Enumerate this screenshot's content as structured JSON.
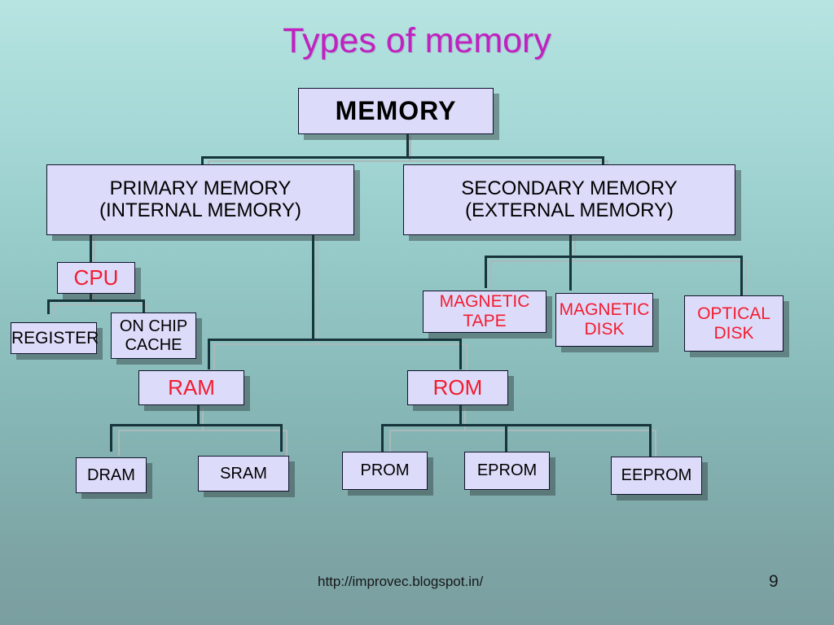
{
  "slide": {
    "title": "Types of memory",
    "title_color": "#c021c0",
    "background_top_color": "#b7e4e1",
    "background_bottom_color": "#7b9fa0",
    "box_fill_color": "#dcdcfa",
    "box_border_color": "#11122b",
    "red_text_color": "#f41b2f",
    "black_text_color": "#000000"
  },
  "footer": {
    "url": "http://improvec.blogspot.in/",
    "page_number": "9"
  },
  "chart_data": {
    "type": "diagram",
    "title": "Types of memory",
    "diagram_kind": "hierarchy-tree",
    "root": "MEMORY",
    "nodes": [
      {
        "id": "memory",
        "label": "MEMORY",
        "text_color": "#000000",
        "level": 0
      },
      {
        "id": "primary",
        "label": "PRIMARY MEMORY\n(INTERNAL MEMORY)",
        "text_color": "#000000",
        "level": 1
      },
      {
        "id": "secondary",
        "label": "SECONDARY MEMORY\n(EXTERNAL MEMORY)",
        "text_color": "#000000",
        "level": 1
      },
      {
        "id": "cpu",
        "label": "CPU",
        "text_color": "#f41b2f",
        "level": 2
      },
      {
        "id": "register",
        "label": "REGISTER",
        "text_color": "#000000",
        "level": 3
      },
      {
        "id": "on-chip-cache",
        "label": "ON CHIP\nCACHE",
        "text_color": "#000000",
        "level": 3
      },
      {
        "id": "ram",
        "label": "RAM",
        "text_color": "#f41b2f",
        "level": 2
      },
      {
        "id": "rom",
        "label": "ROM",
        "text_color": "#f41b2f",
        "level": 2
      },
      {
        "id": "dram",
        "label": "DRAM",
        "text_color": "#000000",
        "level": 3
      },
      {
        "id": "sram",
        "label": "SRAM",
        "text_color": "#000000",
        "level": 3
      },
      {
        "id": "prom",
        "label": "PROM",
        "text_color": "#000000",
        "level": 3
      },
      {
        "id": "eprom",
        "label": "EPROM",
        "text_color": "#000000",
        "level": 3
      },
      {
        "id": "eeprom",
        "label": "EEPROM",
        "text_color": "#000000",
        "level": 3
      },
      {
        "id": "magnetic-tape",
        "label": "MAGNETIC\nTAPE",
        "text_color": "#f41b2f",
        "level": 2
      },
      {
        "id": "magnetic-disk",
        "label": "MAGNETIC\nDISK",
        "text_color": "#f41b2f",
        "level": 2
      },
      {
        "id": "optical-disk",
        "label": "OPTICAL\nDISK",
        "text_color": "#f41b2f",
        "level": 2
      }
    ],
    "edges": [
      {
        "from": "memory",
        "to": "primary"
      },
      {
        "from": "memory",
        "to": "secondary"
      },
      {
        "from": "primary",
        "to": "cpu"
      },
      {
        "from": "primary",
        "to": "ram"
      },
      {
        "from": "primary",
        "to": "rom"
      },
      {
        "from": "cpu",
        "to": "register"
      },
      {
        "from": "cpu",
        "to": "on-chip-cache"
      },
      {
        "from": "ram",
        "to": "dram"
      },
      {
        "from": "ram",
        "to": "sram"
      },
      {
        "from": "rom",
        "to": "prom"
      },
      {
        "from": "rom",
        "to": "eprom"
      },
      {
        "from": "rom",
        "to": "eeprom"
      },
      {
        "from": "secondary",
        "to": "magnetic-tape"
      },
      {
        "from": "secondary",
        "to": "magnetic-disk"
      },
      {
        "from": "secondary",
        "to": "optical-disk"
      }
    ]
  },
  "boxes": {
    "memory": {
      "line1": "MEMORY"
    },
    "primary": {
      "line1": "PRIMARY MEMORY",
      "line2": "(INTERNAL MEMORY)"
    },
    "secondary": {
      "line1": "SECONDARY MEMORY",
      "line2": "(EXTERNAL MEMORY)"
    },
    "cpu": {
      "line1": "CPU"
    },
    "register": {
      "line1": "REGISTER"
    },
    "on_chip_cache": {
      "line1": "ON CHIP",
      "line2": "CACHE"
    },
    "ram": {
      "line1": "RAM"
    },
    "rom": {
      "line1": "ROM"
    },
    "dram": {
      "line1": "DRAM"
    },
    "sram": {
      "line1": "SRAM"
    },
    "prom": {
      "line1": "PROM"
    },
    "eprom": {
      "line1": "EPROM"
    },
    "eeprom": {
      "line1": "EEPROM"
    },
    "magnetic_tape": {
      "line1": "MAGNETIC",
      "line2": "TAPE"
    },
    "magnetic_disk": {
      "line1": "MAGNETIC",
      "line2": "DISK"
    },
    "optical_disk": {
      "line1": "OPTICAL",
      "line2": "DISK"
    }
  }
}
